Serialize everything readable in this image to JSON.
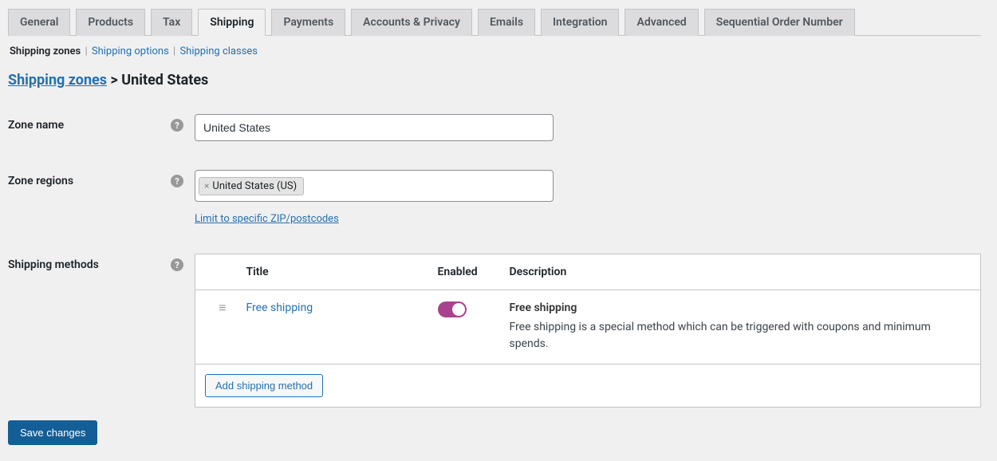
{
  "tabs": {
    "items": [
      {
        "label": "General"
      },
      {
        "label": "Products"
      },
      {
        "label": "Tax"
      },
      {
        "label": "Shipping",
        "active": true
      },
      {
        "label": "Payments"
      },
      {
        "label": "Accounts & Privacy"
      },
      {
        "label": "Emails"
      },
      {
        "label": "Integration"
      },
      {
        "label": "Advanced"
      },
      {
        "label": "Sequential Order Number"
      }
    ]
  },
  "subnav": {
    "zones": "Shipping zones",
    "options": "Shipping options",
    "classes": "Shipping classes"
  },
  "breadcrumb": {
    "root": "Shipping zones",
    "sep": " > ",
    "current": "United States"
  },
  "form": {
    "zone_name_label": "Zone name",
    "zone_name_value": "United States",
    "zone_region_label": "Zone regions",
    "region_chip": "United States (US)",
    "zip_link": "Limit to specific ZIP/postcodes",
    "methods_label": "Shipping methods"
  },
  "methods_table": {
    "headers": {
      "title": "Title",
      "enabled": "Enabled",
      "description": "Description"
    },
    "row": {
      "title": "Free shipping",
      "desc_title": "Free shipping",
      "desc_body": "Free shipping is a special method which can be triggered with coupons and minimum spends."
    },
    "add_button": "Add shipping method"
  },
  "save_button": "Save changes"
}
